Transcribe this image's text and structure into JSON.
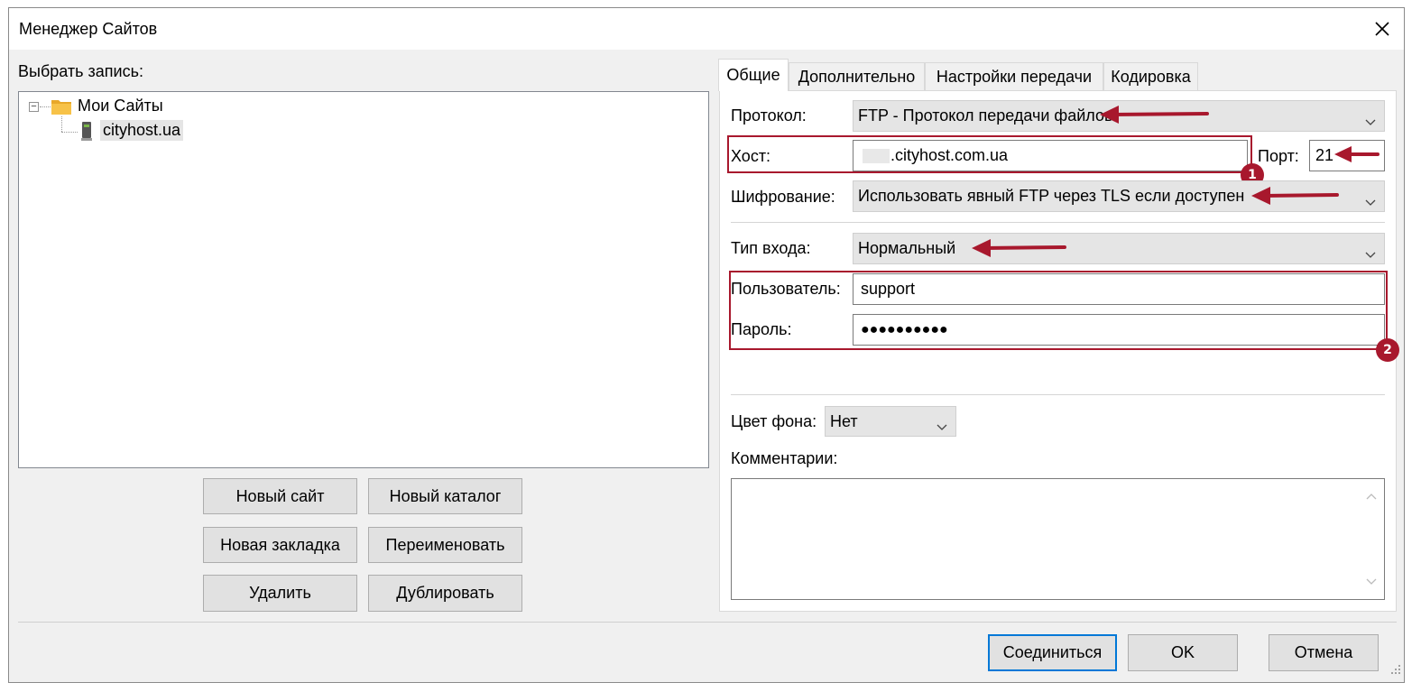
{
  "window": {
    "title": "Менеджер Сайтов"
  },
  "left": {
    "select_label": "Выбрать запись:",
    "tree": {
      "root": "Мои Сайты",
      "child": "cityhost.ua"
    },
    "buttons": {
      "new_site": "Новый сайт",
      "new_folder": "Новый каталог",
      "new_bookmark": "Новая закладка",
      "rename": "Переименовать",
      "delete": "Удалить",
      "duplicate": "Дублировать"
    }
  },
  "tabs": [
    "Общие",
    "Дополнительно",
    "Настройки передачи",
    "Кодировка"
  ],
  "general": {
    "protocol_label": "Протокол:",
    "protocol_value": "FTP - Протокол передачи файлов",
    "host_label": "Хост:",
    "host_value": ".cityhost.com.ua",
    "port_label": "Порт:",
    "port_value": "21",
    "encryption_label": "Шифрование:",
    "encryption_value": "Использовать явный FTP через TLS если доступен",
    "logon_label": "Тип входа:",
    "logon_value": "Нормальный",
    "user_label": "Пользователь:",
    "user_value": "support",
    "password_label": "Пароль:",
    "password_value": "●●●●●●●●●●",
    "bgcolor_label": "Цвет фона:",
    "bgcolor_value": "Нет",
    "comments_label": "Комментарии:"
  },
  "annotations": {
    "badge1": "1",
    "badge2": "2"
  },
  "footer": {
    "connect": "Соединиться",
    "ok": "OK",
    "cancel": "Отмена"
  },
  "colors": {
    "annotation": "#a8182d",
    "focus": "#0078d7"
  }
}
